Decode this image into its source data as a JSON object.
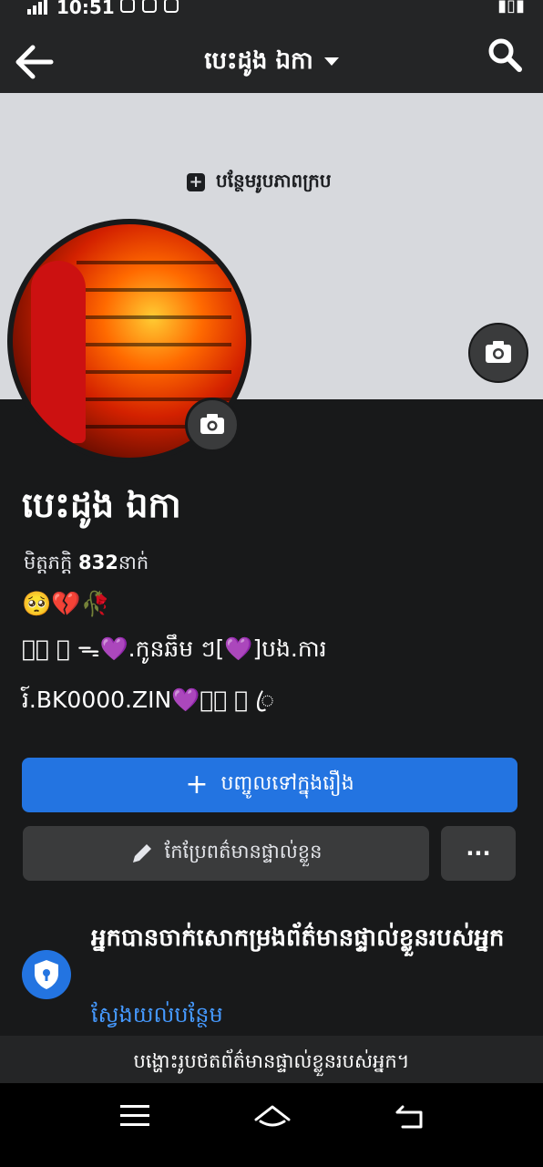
{
  "status_bar": {
    "time": "10:51"
  },
  "header": {
    "title": "បេះដូង ឯកា",
    "back_icon": "arrow-left-icon",
    "search_icon": "search-icon"
  },
  "cover": {
    "add_cover_label": "បន្ថែមរូបភាពក្រប",
    "background": "#d7d9dd"
  },
  "profile": {
    "name": "បេះដូង ឯកា",
    "friends_label": "មិត្តភក្ដិ",
    "friends_count": "832",
    "friends_suffix": "នាក់",
    "bio_line1": "🥺💔🥀",
    "bio_line2": "ꦿ⃟ ⃟ ᯓ💜.កូនឆឹម ៗ[💜]បង.ការ",
    "bio_line3": "រ៍.BK0000.ZIN💜ᯓ⃟ ⃟ ꦿ"
  },
  "actions": {
    "add_story_label": "បញ្ចូលទៅក្នុងរឿង",
    "edit_profile_label": "កែប្រែពត៌មានផ្ទាល់ខ្លួន",
    "more_label": "···"
  },
  "privacy_card": {
    "title": "អ្នកបានចាក់សោកម្រងព័ត៌មានផ្ទាល់ខ្លួនរបស់អ្នក",
    "link": "ស្វែងយល់បន្ថែម"
  },
  "banner": {
    "text": "បង្ហោះរូបថតព័ត៌មានផ្ទាល់ខ្លួនរបស់អ្នក។"
  },
  "colors": {
    "primary_blue": "#2374e1",
    "link_blue": "#4599ff",
    "background": "#18191a",
    "surface": "#242526",
    "button_gray": "#3a3b3c"
  }
}
